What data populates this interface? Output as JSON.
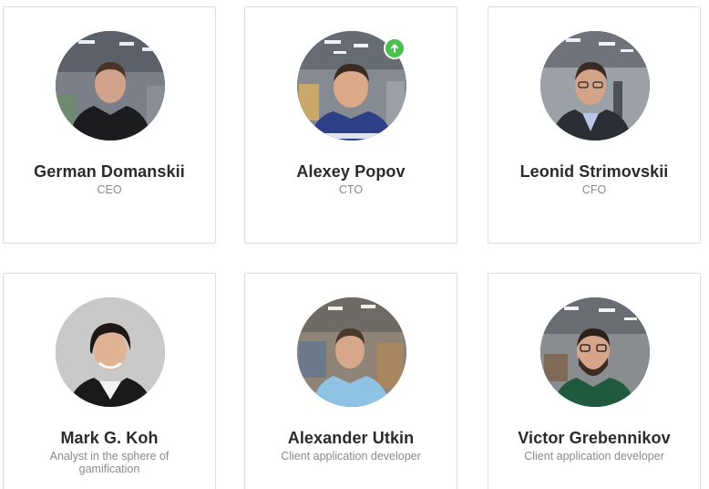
{
  "team": [
    {
      "name": "German Domanskii",
      "role": "CEO",
      "badge": false
    },
    {
      "name": "Alexey Popov",
      "role": "CTO",
      "badge": true
    },
    {
      "name": "Leonid Strimovskii",
      "role": "CFO",
      "badge": false
    },
    {
      "name": "Mark G. Koh",
      "role": "Analyst in the sphere of gamification",
      "badge": false
    },
    {
      "name": "Alexander Utkin",
      "role": "Client application developer",
      "badge": false
    },
    {
      "name": "Victor Grebennikov",
      "role": "Client application developer",
      "badge": false
    }
  ],
  "icons": {
    "badge": "arrow-up-icon"
  },
  "colors": {
    "badge": "#4cbe52",
    "name": "#2b2b2b",
    "role": "#8a8a8a",
    "card_border": "#dcdcdc"
  }
}
